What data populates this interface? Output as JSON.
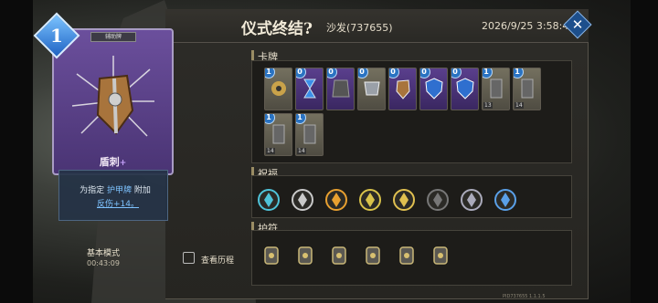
{
  "header": {
    "title": "仪式终结?",
    "player": "沙发(737655)",
    "datetime": "2026/9/25 3:58:40"
  },
  "preview_card": {
    "cost": "1",
    "type_label": "辅助牌",
    "name": "盾刺",
    "upgrade_mark": "+",
    "desc_prefix": "为指定",
    "desc_keyword": "护甲牌",
    "desc_suffix": "附加",
    "desc_effect": "反伤+14。"
  },
  "run": {
    "mode": "基本模式",
    "time": "00:43:09",
    "history_label": "查看历程"
  },
  "sections": {
    "cards": "卡牌",
    "blessings": "祝福",
    "charms": "护符"
  },
  "cards": [
    {
      "cost": "1",
      "theme": "gray",
      "art": "gear",
      "level": ""
    },
    {
      "cost": "0",
      "theme": "purple",
      "art": "hourglass",
      "level": ""
    },
    {
      "cost": "0",
      "theme": "purple",
      "art": "armor",
      "level": ""
    },
    {
      "cost": "0",
      "theme": "gray",
      "art": "shield-plate",
      "level": ""
    },
    {
      "cost": "0",
      "theme": "purple",
      "art": "shield-spiked",
      "level": ""
    },
    {
      "cost": "0",
      "theme": "purple",
      "art": "blue-shield",
      "level": ""
    },
    {
      "cost": "0",
      "theme": "purple",
      "art": "blue-shield",
      "level": ""
    },
    {
      "cost": "1",
      "theme": "gray",
      "art": "gauntlet",
      "level": "13"
    },
    {
      "cost": "1",
      "theme": "gray",
      "art": "gauntlet",
      "level": "14"
    },
    {
      "cost": "1",
      "theme": "gray",
      "art": "gauntlet",
      "level": "14"
    },
    {
      "cost": "1",
      "theme": "gray",
      "art": "gauntlet",
      "level": "14"
    }
  ],
  "blessings": [
    "crystal-icon",
    "claw-icon",
    "flame-swirl-icon",
    "star-gem-icon",
    "wing-icon",
    "skull-orb-icon",
    "cog-icon",
    "shield-flame-icon"
  ],
  "charms": [
    "armor-charm-icon",
    "helmet-charm-icon",
    "bracer-charm-icon",
    "gauntlet-charm-icon",
    "amulet-charm-icon",
    "cloak-charm-icon"
  ],
  "version": "PID737655 1.1.1.5",
  "colors": {
    "accent": "#1d4f8c",
    "cost_blue": "#2a73c2",
    "purple_card": "#5a3f8d"
  }
}
